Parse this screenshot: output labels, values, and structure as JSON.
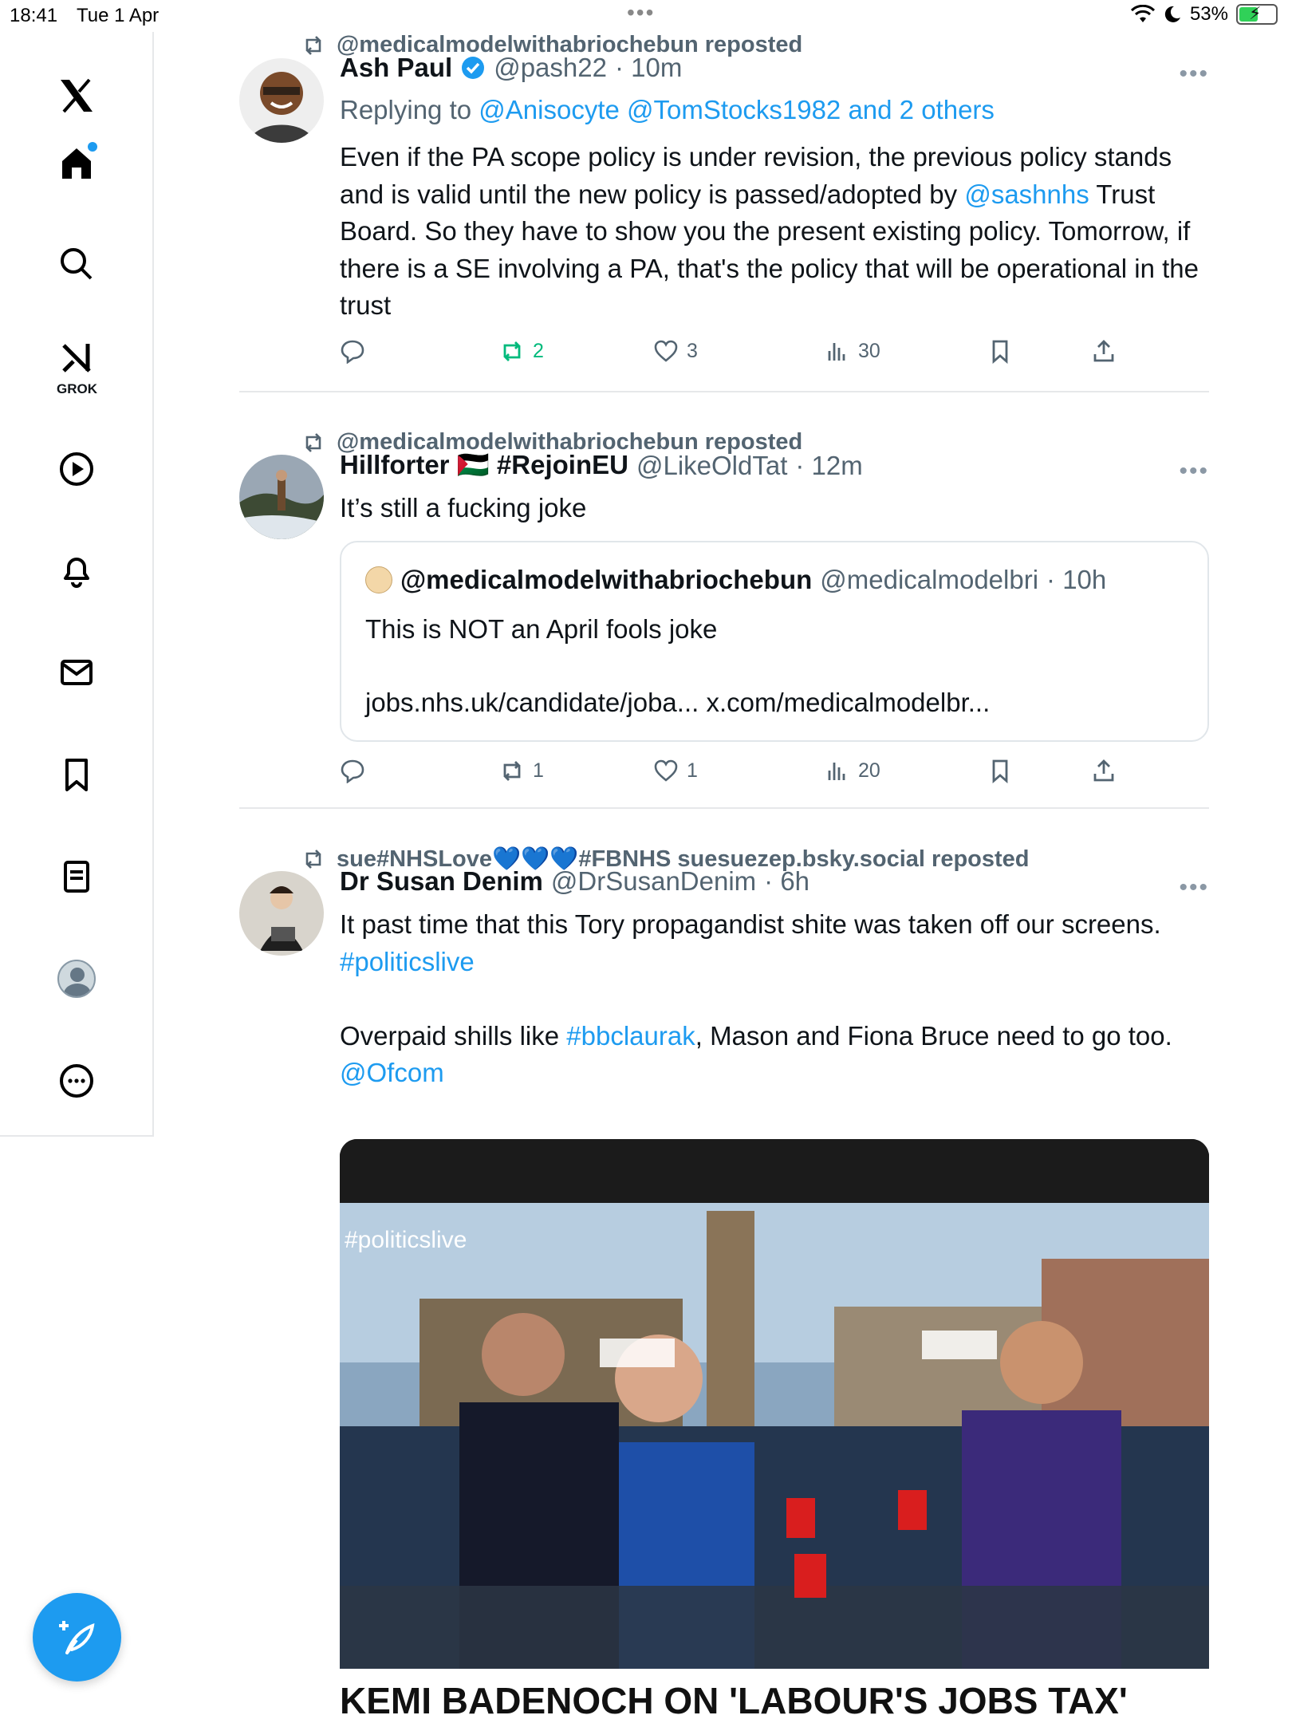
{
  "status_bar": {
    "time": "18:41",
    "date": "Tue 1 Apr",
    "battery": "53%",
    "battery_level": 0.53,
    "multitask_dots": "•••"
  },
  "sidebar": {
    "grok_label": "GROK",
    "items": [
      "x-logo",
      "home",
      "search",
      "grok",
      "videos",
      "notifications",
      "messages",
      "bookmarks",
      "lists",
      "profile",
      "more"
    ]
  },
  "colors": {
    "accent": "#1d9bf0",
    "repost_green": "#00ba7c",
    "text_secondary": "#536471"
  },
  "tweets": [
    {
      "repost_by": "@medicalmodelwithabriochebun reposted",
      "name": "Ash Paul",
      "verified": true,
      "handle": "@pash22",
      "time": "· 10m",
      "replying_prefix": "Replying to ",
      "replying_to": "@Anisocyte @TomStocks1982 and 2 others",
      "text_1": "Even if the PA scope policy is under revision, the previous policy stands and is valid until the new policy is passed/adopted by ",
      "mention": "@sashnhs",
      "text_2": " Trust Board. So they have to show you the present existing policy. Tomorrow, if there is a SE involving a PA, that's the policy that will be operational in the trust",
      "more": "•••",
      "replies": "",
      "reposts": "2",
      "likes": "3",
      "views": "30"
    },
    {
      "repost_by": "@medicalmodelwithabriochebun reposted",
      "name": "Hillforter 🇵🇸 #RejoinEU",
      "handle": "@LikeOldTat",
      "time": "· 12m",
      "text": "It’s still a fucking joke",
      "more": "•••",
      "quote": {
        "name": "@medicalmodelwithabriochebun",
        "handle": "@medicalmodelbri",
        "time": "· 10h",
        "text": "This is NOT an April fools joke",
        "links": "jobs.nhs.uk/candidate/joba... x.com/medicalmodelbr..."
      },
      "replies": "",
      "reposts": "1",
      "likes": "1",
      "views": "20"
    },
    {
      "repost_by": "sue#NHSLove💙💙💙#FBNHS suesuezep.bsky.social reposted",
      "name": "Dr Susan Denim",
      "handle": "@DrSusanDenim",
      "time": "· 6h",
      "text_1": "It past time that this Tory propagandist shite was taken off our screens. ",
      "hashtag_1": "#politicslive",
      "text_2": "Overpaid shills like ",
      "hashtag_2": "#bbclaurak",
      "text_3": ", Mason and Fiona Bruce need to go too. ",
      "mention": "@Ofcom",
      "more": "•••",
      "media": {
        "overlay_tag": "#politicslive",
        "caption": "KEMI BADENOCH ON 'LABOUR'S JOBS TAX'"
      }
    }
  ]
}
